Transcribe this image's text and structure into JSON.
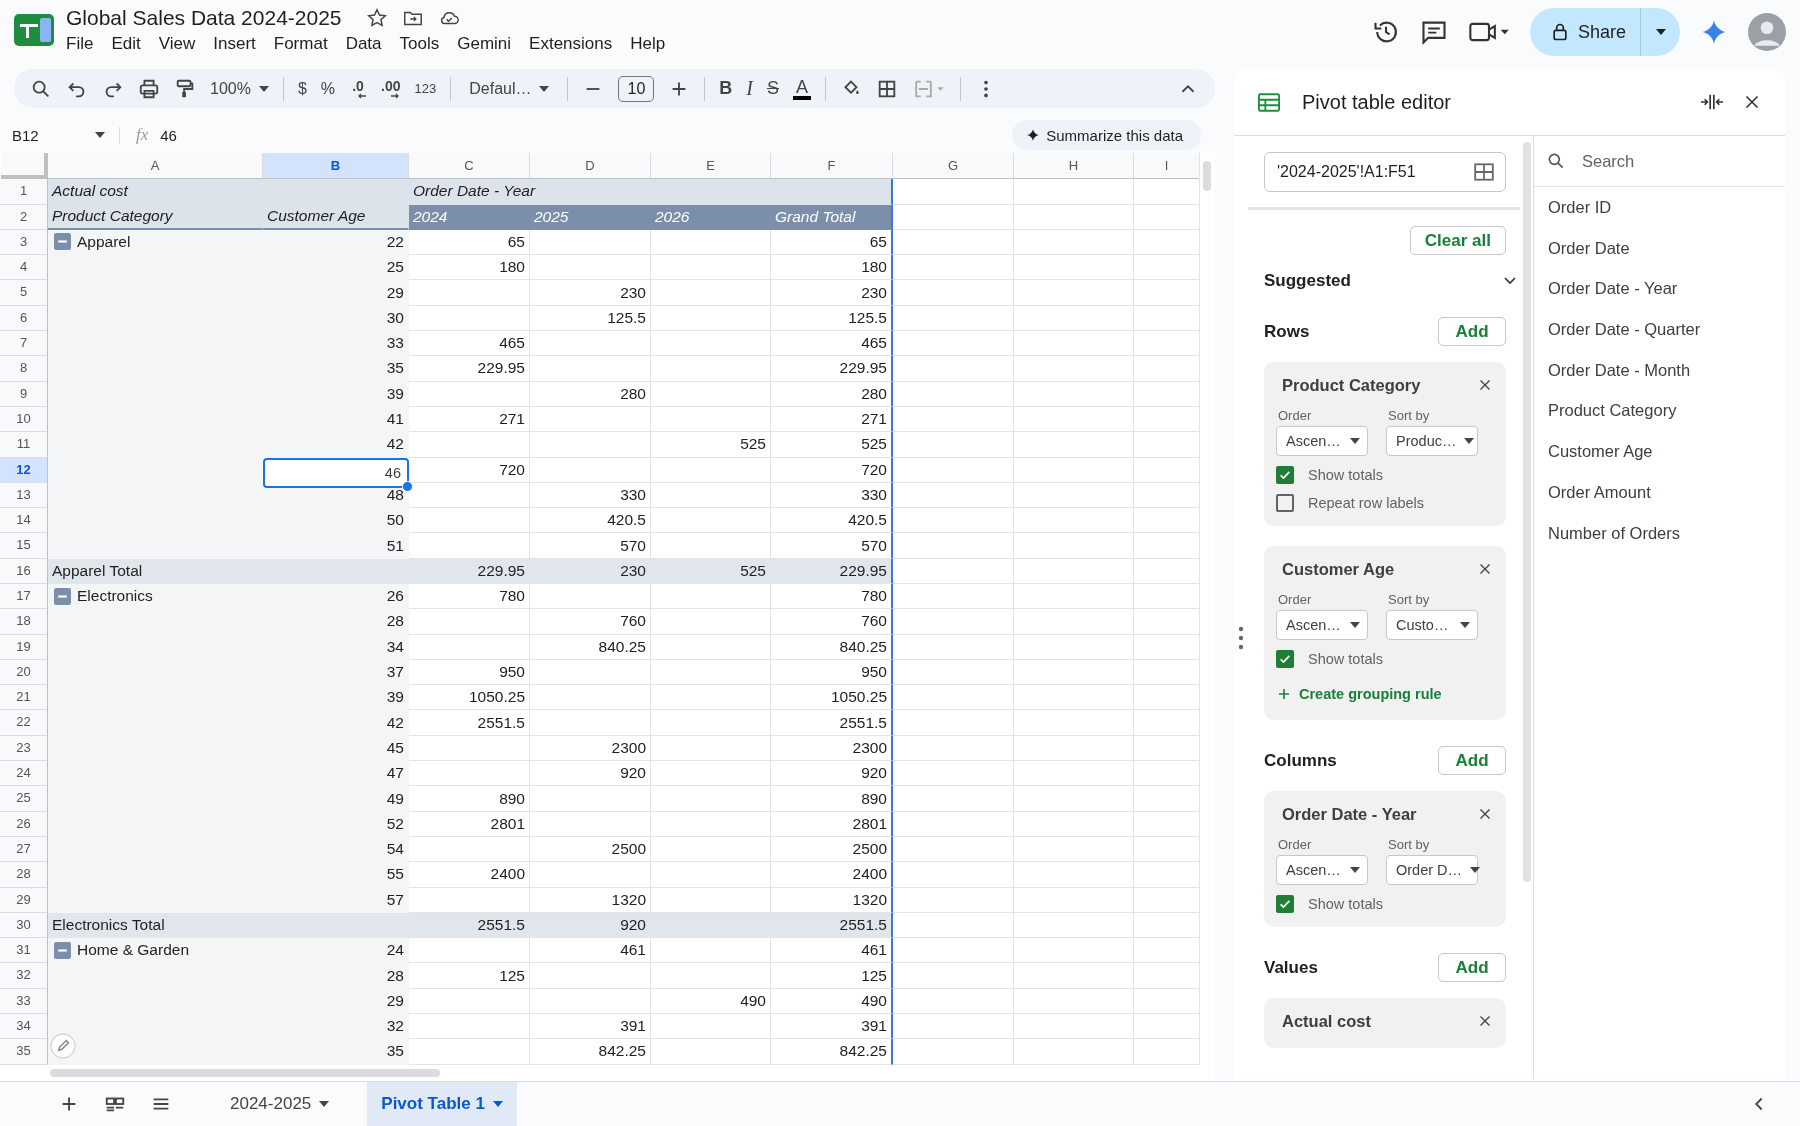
{
  "document": {
    "title": "Global Sales Data 2024-2025"
  },
  "menu": [
    "File",
    "Edit",
    "View",
    "Insert",
    "Format",
    "Data",
    "Tools",
    "Gemini",
    "Extensions",
    "Help"
  ],
  "share_button": {
    "label": "Share"
  },
  "toolbar": {
    "zoom": "100%",
    "currency": "$",
    "percent": "%",
    "decrease_decimal": ".0",
    "increase_decimal": ".00",
    "number_format": "123",
    "font": "Defaul…",
    "font_size": "10",
    "bold": "B",
    "italic": "I",
    "strikethrough": "S",
    "text_color": "A"
  },
  "formula_bar": {
    "cell": "B12",
    "fx": "fx",
    "value": "46",
    "summarize_button": "Summarize this data"
  },
  "columns": [
    {
      "label": "A",
      "selected": false
    },
    {
      "label": "B",
      "selected": true
    },
    {
      "label": "C",
      "selected": false
    },
    {
      "label": "D",
      "selected": false
    },
    {
      "label": "E",
      "selected": false
    },
    {
      "label": "F",
      "selected": false
    },
    {
      "label": "G",
      "selected": false
    },
    {
      "label": "H",
      "selected": false
    },
    {
      "label": "I",
      "selected": false
    }
  ],
  "rows": [
    {
      "n": "1",
      "kind": "label",
      "selected": false,
      "cells": {
        "a": "Actual cost",
        "c": "Order Date - Year"
      }
    },
    {
      "n": "2",
      "kind": "header",
      "selected": false,
      "cells": {
        "a": "Product Category",
        "b": "Customer Age",
        "c": "2024",
        "d": "2025",
        "e": "2026",
        "f": "Grand Total"
      }
    },
    {
      "n": "3",
      "kind": "group",
      "selected": false,
      "cells": {
        "a": "Apparel",
        "b": "22",
        "c": "65",
        "f": "65"
      }
    },
    {
      "n": "4",
      "kind": "item",
      "selected": false,
      "cells": {
        "b": "25",
        "c": "180",
        "f": "180"
      }
    },
    {
      "n": "5",
      "kind": "item",
      "selected": false,
      "cells": {
        "b": "29",
        "d": "230",
        "f": "230"
      }
    },
    {
      "n": "6",
      "kind": "item",
      "selected": false,
      "cells": {
        "b": "30",
        "d": "125.5",
        "f": "125.5"
      }
    },
    {
      "n": "7",
      "kind": "item",
      "selected": false,
      "cells": {
        "b": "33",
        "c": "465",
        "f": "465"
      }
    },
    {
      "n": "8",
      "kind": "item",
      "selected": false,
      "cells": {
        "b": "35",
        "c": "229.95",
        "f": "229.95"
      }
    },
    {
      "n": "9",
      "kind": "item",
      "selected": false,
      "cells": {
        "b": "39",
        "d": "280",
        "f": "280"
      }
    },
    {
      "n": "10",
      "kind": "item",
      "selected": false,
      "cells": {
        "b": "41",
        "c": "271",
        "f": "271"
      }
    },
    {
      "n": "11",
      "kind": "item",
      "selected": false,
      "cells": {
        "b": "42",
        "e": "525",
        "f": "525"
      }
    },
    {
      "n": "12",
      "kind": "item",
      "selected": true,
      "cells": {
        "b": "46",
        "c": "720",
        "f": "720"
      }
    },
    {
      "n": "13",
      "kind": "item",
      "selected": false,
      "cells": {
        "b": "48",
        "d": "330",
        "f": "330"
      }
    },
    {
      "n": "14",
      "kind": "item",
      "selected": false,
      "cells": {
        "b": "50",
        "d": "420.5",
        "f": "420.5"
      }
    },
    {
      "n": "15",
      "kind": "item",
      "selected": false,
      "cells": {
        "b": "51",
        "d": "570",
        "f": "570"
      }
    },
    {
      "n": "16",
      "kind": "total",
      "selected": false,
      "cells": {
        "a": "Apparel Total",
        "c": "229.95",
        "d": "230",
        "e": "525",
        "f": "229.95"
      }
    },
    {
      "n": "17",
      "kind": "group",
      "selected": false,
      "cells": {
        "a": "Electronics",
        "b": "26",
        "c": "780",
        "f": "780"
      }
    },
    {
      "n": "18",
      "kind": "item",
      "selected": false,
      "cells": {
        "b": "28",
        "d": "760",
        "f": "760"
      }
    },
    {
      "n": "19",
      "kind": "item",
      "selected": false,
      "cells": {
        "b": "34",
        "d": "840.25",
        "f": "840.25"
      }
    },
    {
      "n": "20",
      "kind": "item",
      "selected": false,
      "cells": {
        "b": "37",
        "c": "950",
        "f": "950"
      }
    },
    {
      "n": "21",
      "kind": "item",
      "selected": false,
      "cells": {
        "b": "39",
        "c": "1050.25",
        "f": "1050.25"
      }
    },
    {
      "n": "22",
      "kind": "item",
      "selected": false,
      "cells": {
        "b": "42",
        "c": "2551.5",
        "f": "2551.5"
      }
    },
    {
      "n": "23",
      "kind": "item",
      "selected": false,
      "cells": {
        "b": "45",
        "d": "2300",
        "f": "2300"
      }
    },
    {
      "n": "24",
      "kind": "item",
      "selected": false,
      "cells": {
        "b": "47",
        "d": "920",
        "f": "920"
      }
    },
    {
      "n": "25",
      "kind": "item",
      "selected": false,
      "cells": {
        "b": "49",
        "c": "890",
        "f": "890"
      }
    },
    {
      "n": "26",
      "kind": "item",
      "selected": false,
      "cells": {
        "b": "52",
        "c": "2801",
        "f": "2801"
      }
    },
    {
      "n": "27",
      "kind": "item",
      "selected": false,
      "cells": {
        "b": "54",
        "d": "2500",
        "f": "2500"
      }
    },
    {
      "n": "28",
      "kind": "item",
      "selected": false,
      "cells": {
        "b": "55",
        "c": "2400",
        "f": "2400"
      }
    },
    {
      "n": "29",
      "kind": "item",
      "selected": false,
      "cells": {
        "b": "57",
        "d": "1320",
        "f": "1320"
      }
    },
    {
      "n": "30",
      "kind": "total",
      "selected": false,
      "cells": {
        "a": "Electronics Total",
        "c": "2551.5",
        "d": "920",
        "f": "2551.5"
      }
    },
    {
      "n": "31",
      "kind": "group",
      "selected": false,
      "cells": {
        "a": "Home & Garden",
        "b": "24",
        "d": "461",
        "f": "461"
      }
    },
    {
      "n": "32",
      "kind": "item",
      "selected": false,
      "cells": {
        "b": "28",
        "c": "125",
        "f": "125"
      }
    },
    {
      "n": "33",
      "kind": "item",
      "selected": false,
      "cells": {
        "b": "29",
        "e": "490",
        "f": "490"
      }
    },
    {
      "n": "34",
      "kind": "item",
      "selected": false,
      "cells": {
        "b": "32",
        "d": "391",
        "f": "391"
      }
    },
    {
      "n": "35",
      "kind": "item",
      "selected": false,
      "cells": {
        "b": "35",
        "d": "842.25",
        "f": "842.25"
      }
    }
  ],
  "sheet_tabs": [
    {
      "label": "2024-2025",
      "selected": false
    },
    {
      "label": "Pivot Table 1",
      "selected": true
    }
  ],
  "pivot_editor": {
    "title": "Pivot table editor",
    "range": "'2024-2025'!A1:F51",
    "clear_button": "Clear all",
    "suggested": "Suggested",
    "sections": [
      {
        "title": "Rows",
        "add_button": "Add",
        "cards": [
          {
            "title": "Product Category",
            "order_label": "Order",
            "order": "Ascen…",
            "sort_label": "Sort by",
            "sort": "Produc…",
            "options": [
              {
                "label": "Show totals",
                "checked": true
              },
              {
                "label": "Repeat row labels",
                "checked": false
              }
            ]
          },
          {
            "title": "Customer Age",
            "order_label": "Order",
            "order": "Ascen…",
            "sort_label": "Sort by",
            "sort": "Custo…",
            "options": [
              {
                "label": "Show totals",
                "checked": true
              }
            ],
            "link": "Create grouping rule"
          }
        ]
      },
      {
        "title": "Columns",
        "add_button": "Add",
        "cards": [
          {
            "title": "Order Date - Year",
            "order_label": "Order",
            "order": "Ascen…",
            "sort_label": "Sort by",
            "sort": "Order D…",
            "options": [
              {
                "label": "Show totals",
                "checked": true
              }
            ]
          }
        ]
      },
      {
        "title": "Values",
        "add_button": "Add",
        "cards": [
          {
            "title": "Actual cost"
          }
        ]
      }
    ],
    "search": {
      "placeholder": "Search"
    },
    "fields": [
      "Order ID",
      "Order Date",
      "Order Date - Year",
      "Order Date - Quarter",
      "Order Date - Month",
      "Product Category",
      "Customer Age",
      "Order Amount",
      "Number of Orders"
    ]
  }
}
